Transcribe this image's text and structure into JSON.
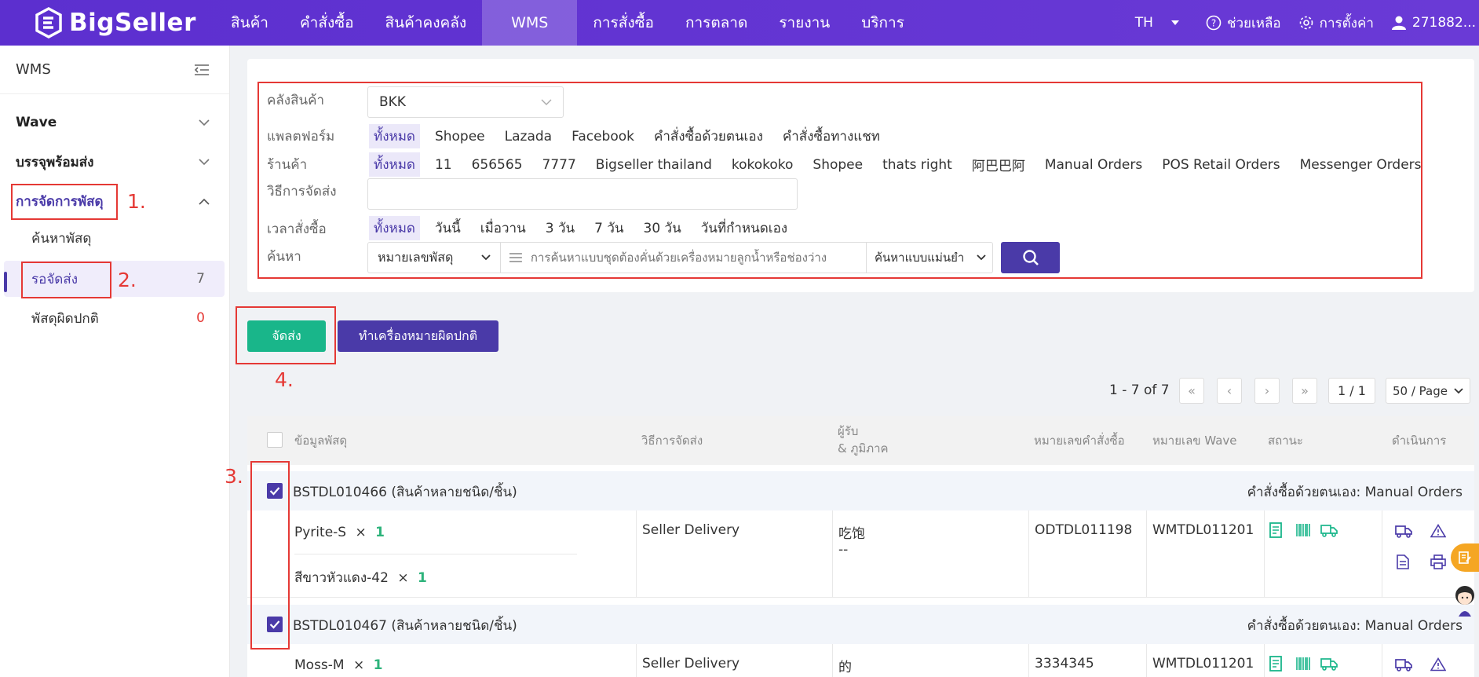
{
  "brand": {
    "name": "BigSeller"
  },
  "nav": [
    {
      "label": "สินค้า"
    },
    {
      "label": "คำสั่งซื้อ"
    },
    {
      "label": "สินค้าคงคลัง"
    },
    {
      "label": "WMS",
      "active": true
    },
    {
      "label": "การสั่งซื้อ"
    },
    {
      "label": "การตลาด"
    },
    {
      "label": "รายงาน"
    },
    {
      "label": "บริการ"
    }
  ],
  "topright": {
    "lang": "TH",
    "help": "ช่วยเหลือ",
    "settings": "การตั้งค่า",
    "user": "271882..."
  },
  "sidebar": {
    "title": "WMS",
    "groups": [
      {
        "label": "Wave"
      },
      {
        "label": "บรรจุพร้อมส่ง"
      },
      {
        "label": "การจัดการพัสดุ"
      }
    ],
    "items": [
      {
        "label": "ค้นหาพัสดุ",
        "count": ""
      },
      {
        "label": "รอจัดส่ง",
        "count": "7"
      },
      {
        "label": "พัสดุผิดปกติ",
        "count": "0"
      }
    ]
  },
  "filters": {
    "warehouse_label": "คลังสินค้า",
    "warehouse_value": "BKK",
    "platform_label": "แพลตฟอร์ม",
    "platforms": [
      "ทั้งหมด",
      "Shopee",
      "Lazada",
      "Facebook",
      "คำสั่งซื้อด้วยตนเอง",
      "คำสั่งซื้อทางแชท"
    ],
    "store_label": "ร้านค้า",
    "stores": [
      "ทั้งหมด",
      "11",
      "656565",
      "7777",
      "Bigseller thailand",
      "kokokoko",
      "Shopee",
      "thats right",
      "阿巴巴阿",
      "Manual Orders",
      "POS Retail Orders",
      "Messenger Orders"
    ],
    "shipping_label": "วิธีการจัดส่ง",
    "time_label": "เวลาสั่งซื้อ",
    "times": [
      "ทั้งหมด",
      "วันนี้",
      "เมื่อวาน",
      "3 วัน",
      "7 วัน",
      "30 วัน",
      "วันที่กำหนดเอง"
    ],
    "search_label": "ค้นหา",
    "search_type": "หมายเลขพัสดุ",
    "search_placeholder": "การค้นหาแบบชุดต้องคั่นด้วยเครื่องหมายลูกน้ำหรือช่องว่าง",
    "search_mode": "ค้นหาแบบแม่นยำ"
  },
  "actions": {
    "ship": "จัดส่ง",
    "mark_abnormal": "ทำเครื่องหมายผิดปกติ"
  },
  "pagination": {
    "summary": "1 - 7 of 7",
    "page": "1 / 1",
    "per_page": "50 / Page"
  },
  "table": {
    "headers": {
      "info": "ข้อมูลพัสดุ",
      "shipping": "วิธีการจัดส่ง",
      "recipient": "ผู้รับ",
      "region": "& ภูมิภาค",
      "order_no": "หมายเลขคำสั่งซื้อ",
      "wave_no": "หมายเลข Wave",
      "status": "สถานะ",
      "ops": "ดำเนินการ"
    },
    "packages": [
      {
        "id": "BSTDL010466 (สินค้าหลายชนิด/ชิ้น)",
        "source": "คำสั่งซื้อด้วยตนเอง: Manual Orders",
        "items": [
          {
            "name": "Pyrite-S",
            "x": "×",
            "qty": "1"
          },
          {
            "name": "สีขาวหัวแดง-42",
            "x": "×",
            "qty": "1"
          }
        ],
        "shipping": "Seller Delivery",
        "recipient": "吃饱",
        "region": "--",
        "order_no": "ODTDL011198",
        "wave_no": "WMTDL011201"
      },
      {
        "id": "BSTDL010467 (สินค้าหลายชนิด/ชิ้น)",
        "source": "คำสั่งซื้อด้วยตนเอง: Manual Orders",
        "items": [
          {
            "name": "Moss-M",
            "x": "×",
            "qty": "1"
          }
        ],
        "shipping": "Seller Delivery",
        "recipient": "的",
        "region": "",
        "order_no": "3334345",
        "wave_no": "WMTDL011201"
      }
    ]
  },
  "annotations": [
    "1.",
    "2.",
    "3.",
    "4."
  ],
  "colors": {
    "brand": "#5c2fcf",
    "accent": "#4a3aa8",
    "green": "#19b68a",
    "annotation": "#e53935"
  }
}
